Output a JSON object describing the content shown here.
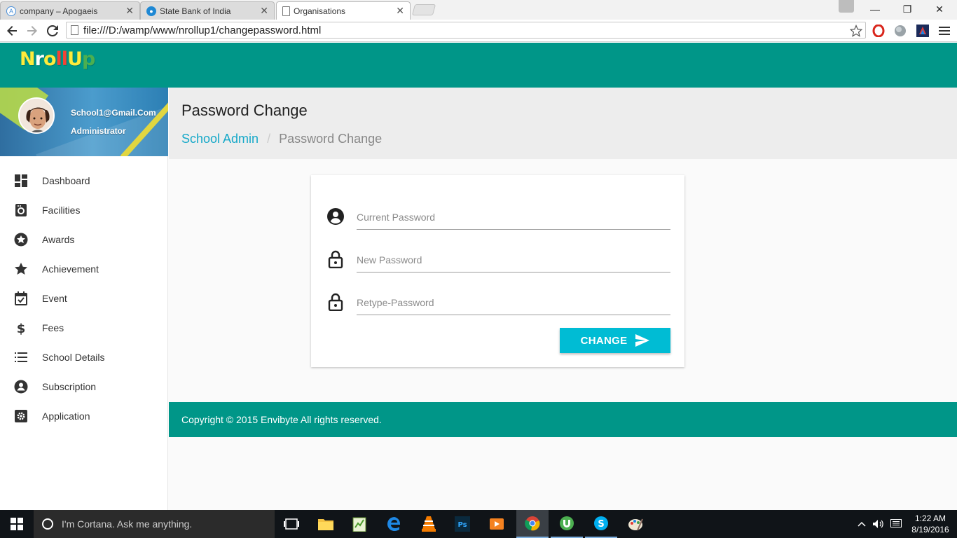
{
  "browser": {
    "tabs": [
      {
        "label": "company – Apogaeis",
        "active": false
      },
      {
        "label": "State Bank of India",
        "active": false
      },
      {
        "label": "Organisations",
        "active": true
      }
    ],
    "url": "file:///D:/wamp/www/nrollup1/changepassword.html"
  },
  "app": {
    "logo_letters": [
      "N",
      "r",
      "o",
      "l",
      "l",
      "U",
      "p"
    ],
    "logo_colors": [
      "#ffeb3b",
      "#ffffff",
      "#ffeb3b",
      "#f44336",
      "#f44336",
      "#ffeb3b",
      "#4caf50"
    ],
    "accent_color": "#009688",
    "button_color": "#00bcd4",
    "link_color": "#17a9c9"
  },
  "user": {
    "email": "School1@Gmail.Com",
    "role": "Administrator"
  },
  "sidebar": {
    "items": [
      {
        "label": "Dashboard",
        "icon": "dashboard-icon"
      },
      {
        "label": "Facilities",
        "icon": "facilities-icon"
      },
      {
        "label": "Awards",
        "icon": "award-icon"
      },
      {
        "label": "Achievement",
        "icon": "star-icon"
      },
      {
        "label": "Event",
        "icon": "event-icon"
      },
      {
        "label": "Fees",
        "icon": "dollar-icon"
      },
      {
        "label": "School Details",
        "icon": "list-icon"
      },
      {
        "label": "Subscription",
        "icon": "subscription-icon"
      },
      {
        "label": "Application",
        "icon": "settings-icon"
      }
    ]
  },
  "page": {
    "title": "Password Change",
    "breadcrumb": {
      "parent": "School Admin",
      "separator": "/",
      "current": "Password Change"
    }
  },
  "form": {
    "current_password": {
      "placeholder": "Current Password",
      "value": "",
      "icon": "account-circle-icon"
    },
    "new_password": {
      "placeholder": "New Password",
      "value": "",
      "icon": "lock-icon"
    },
    "retype_password": {
      "placeholder": "Retype-Password",
      "value": "",
      "icon": "lock-icon"
    },
    "submit_label": "CHANGE",
    "submit_icon": "send-icon"
  },
  "footer": {
    "text": "Copyright © 2015 Envibyte All rights reserved."
  },
  "taskbar": {
    "cortana_placeholder": "I'm Cortana. Ask me anything.",
    "time": "1:22 AM",
    "date": "8/19/2016"
  }
}
